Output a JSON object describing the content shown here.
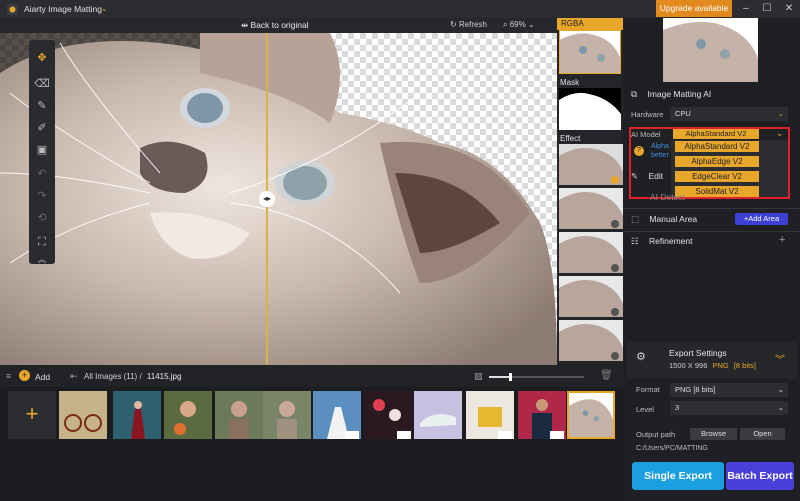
{
  "app": {
    "title": "Aiarty Image Matting",
    "upgrade_label": "Upgrade available",
    "window_controls": [
      "minimize-icon",
      "maximize-icon",
      "close-icon"
    ]
  },
  "canvas_header": {
    "back_label": "Back to original",
    "refresh_label": "Refresh",
    "zoom_value": "69%"
  },
  "side_strip": {
    "rgba_label": "RGBA",
    "mask_label": "Mask",
    "effect_label": "Effect"
  },
  "right_panel": {
    "section_title": "Image Matting AI",
    "hardware_label": "Hardware",
    "hardware_value": "CPU",
    "ai_model_label": "AI Model",
    "ai_model_value": "AlphaStandard  V2",
    "model_options": [
      "AlphaStandard  V2",
      "AlphaEdge  V2",
      "EdgeClear  V2",
      "SolidMat  V2"
    ],
    "hint_text": "Alpha",
    "hint_text2": "better",
    "edit_label": "Edit",
    "ai_detect_label": "AI Detect",
    "manual_area_label": "Manual Area",
    "add_area_label": "+Add Area",
    "refinement_label": "Refinement",
    "export_title": "Export Settings",
    "export_detail": "1500 X 996",
    "export_format_tag": "PNG",
    "export_bits_tag": "[8 bits]",
    "format_label": "Format",
    "format_value": "PNG  [8 bits]",
    "level_label": "Level",
    "level_value": "3",
    "output_label": "Output path",
    "browse_label": "Browse",
    "open_label": "Open",
    "output_path": "C:/Users/PC/MATTING",
    "single_export_label": "Single Export",
    "batch_export_label": "Batch Export"
  },
  "bottom": {
    "add_label": "Add",
    "all_images_label": "All Images (11)",
    "separator": "/",
    "current_file": "11415.jpg"
  },
  "colors": {
    "accent": "#e8a62a",
    "highlight_outline": "#e0202a",
    "single_export": "#1a9fe0",
    "batch_export": "#4a3fd9"
  }
}
